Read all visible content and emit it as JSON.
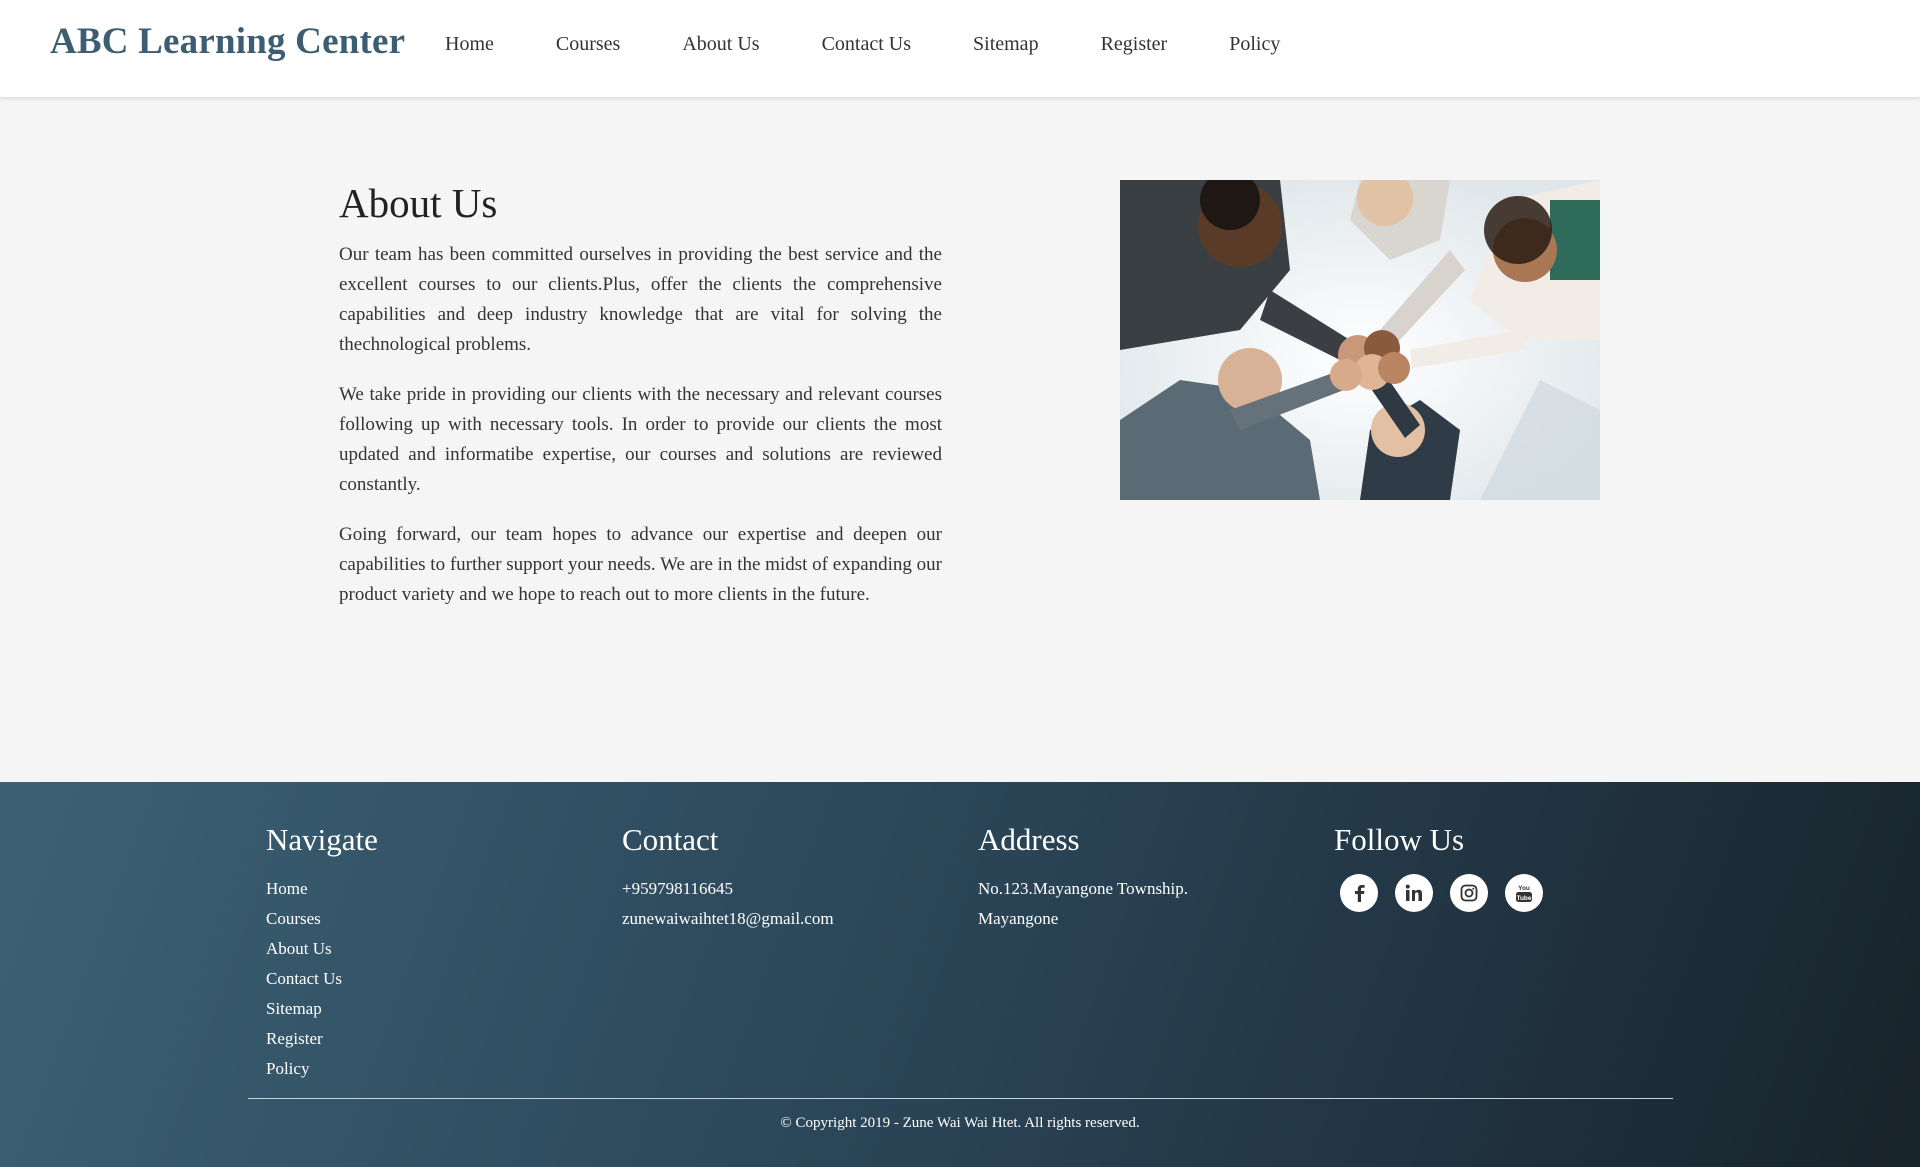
{
  "header": {
    "brand": "ABC Learning Center",
    "nav": [
      "Home",
      "Courses",
      "About Us",
      "Contact Us",
      "Sitemap",
      "Register",
      "Policy"
    ]
  },
  "about": {
    "title": "About Us",
    "paragraphs": [
      "Our team has been committed ourselves in providing the best service and the excellent courses to our clients.Plus, offer the clients the comprehensive capabilities and deep industry knowledge that are vital for solving the thechnological problems.",
      "We take pride in providing our clients with the necessary and relevant courses following up with necessary tools. In order to provide our clients the most updated and informatibe expertise, our courses and solutions are reviewed constantly.",
      "Going forward, our team hopes to advance our expertise and deepen our capabilities to further support your needs. We are in the midst of expanding our product variety and we hope to reach out to more clients in the future."
    ]
  },
  "footer": {
    "navigate": {
      "heading": "Navigate",
      "links": [
        "Home",
        "Courses",
        "About Us",
        "Contact Us",
        "Sitemap",
        "Register",
        "Policy"
      ]
    },
    "contact": {
      "heading": "Contact",
      "phone": "+959798116645",
      "email": "zunewaiwaihtet18@gmail.com"
    },
    "address": {
      "heading": "Address",
      "line1": "No.123.Mayangone Township.",
      "line2": "Mayangone"
    },
    "follow": {
      "heading": "Follow Us",
      "icons": [
        "facebook-icon",
        "linkedin-icon",
        "instagram-icon",
        "youtube-icon"
      ]
    },
    "copyright": "© Copyright 2019 - Zune Wai Wai Htet. All rights reserved."
  },
  "colors": {
    "brand": "#3d5e72",
    "footer_start": "#3c6175",
    "footer_end": "#18232b",
    "page_bg": "#f5f5f5"
  }
}
